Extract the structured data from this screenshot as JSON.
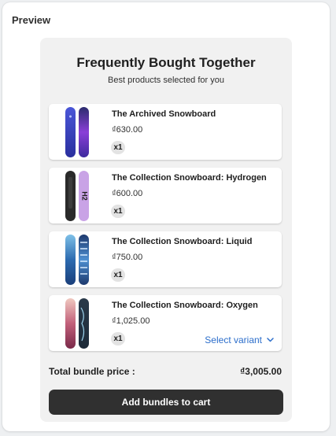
{
  "panel": {
    "title": "Preview"
  },
  "widget": {
    "heading": "Frequently Bought Together",
    "subheading": "Best products selected for you"
  },
  "products": [
    {
      "name": "The Archived Snowboard",
      "price": "₫630.00",
      "quantity": "x1",
      "image": "snowboard-archived-icon"
    },
    {
      "name": "The Collection Snowboard: Hydrogen",
      "price": "₫600.00",
      "quantity": "x1",
      "image": "snowboard-hydrogen-icon"
    },
    {
      "name": "The Collection Snowboard: Liquid",
      "price": "₫750.00",
      "quantity": "x1",
      "image": "snowboard-liquid-icon"
    },
    {
      "name": "The Collection Snowboard: Oxygen",
      "price": "₫1,025.00",
      "quantity": "x1",
      "image": "snowboard-oxygen-icon",
      "variant_label": "Select variant"
    }
  ],
  "bundle": {
    "total_label": "Total bundle price :",
    "total_value": "₫3,005.00",
    "add_button_label": "Add bundles to cart"
  },
  "colors": {
    "button_bg": "#303030",
    "link": "#2c6ecb",
    "widget_bg": "#f1f1f1"
  }
}
